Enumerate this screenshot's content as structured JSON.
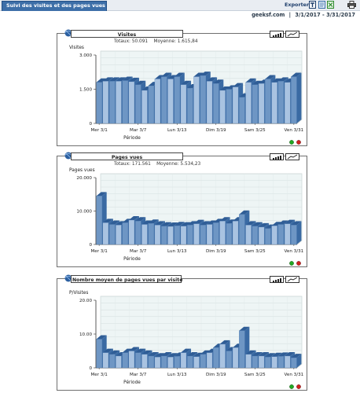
{
  "header": {
    "tab_title": "Suivi des visites et des pages vues",
    "export_label": "Exporter",
    "site": "geeksf.com",
    "separator": "|",
    "date_range": "3/1/2017 - 3/31/2017"
  },
  "chart_data": [
    {
      "type": "bar",
      "title": "Visites",
      "summary": "Totaux: 50.091    Moyenne: 1.615,84",
      "ylabel": "Visites",
      "xlabel": "Période",
      "ylim": [
        0,
        3000
      ],
      "yticks": [
        "0",
        "1.500",
        "3.000"
      ],
      "tick_labels": [
        "Mer 3/1",
        "Mar 3/7",
        "Lun 3/13",
        "Dim 3/19",
        "Sam 3/25",
        "Ven 3/31"
      ],
      "tick_days": [
        1,
        7,
        13,
        19,
        25,
        31
      ],
      "values": [
        1800,
        1850,
        1850,
        1850,
        1880,
        1830,
        1700,
        1450,
        1650,
        1950,
        2050,
        1950,
        2050,
        1700,
        1550,
        2050,
        2100,
        1850,
        1750,
        1450,
        1500,
        1600,
        1150,
        1800,
        1700,
        1750,
        1950,
        1800,
        1850,
        1800,
        2050
      ]
    },
    {
      "type": "bar",
      "title": "Pages vues",
      "summary": "Totaux: 171.561    Moyenne: 5.534,23",
      "ylabel": "Pages vues",
      "xlabel": "Période",
      "ylim": [
        0,
        20000
      ],
      "yticks": [
        "0",
        "10.000",
        "20.000"
      ],
      "tick_labels": [
        "Mer 3/1",
        "Mar 3/7",
        "Lun 3/13",
        "Dim 3/19",
        "Sam 3/25",
        "Ven 3/31"
      ],
      "tick_days": [
        1,
        7,
        13,
        19,
        25,
        31
      ],
      "values": [
        14500,
        6500,
        6000,
        5800,
        6500,
        7300,
        7000,
        6000,
        6300,
        5800,
        5500,
        5400,
        5600,
        5500,
        5800,
        6200,
        5800,
        6000,
        6500,
        7000,
        6300,
        7000,
        9000,
        5800,
        5500,
        5200,
        4800,
        5600,
        6000,
        6200,
        5800
      ]
    },
    {
      "type": "bar",
      "title": "Nombre moyen de pages vues par visite",
      "summary": "",
      "ylabel": "P/Visites",
      "xlabel": "Période",
      "ylim": [
        0,
        20
      ],
      "yticks": [
        "0",
        "10.00",
        "20.00"
      ],
      "tick_labels": [
        "Mer 3/1",
        "Mar 3/7",
        "Lun 3/13",
        "Dim 3/19",
        "Sam 3/25",
        "Ven 3/31"
      ],
      "tick_days": [
        1,
        7,
        13,
        19,
        25,
        31
      ],
      "values": [
        8.5,
        4.5,
        4,
        3.5,
        4.5,
        5,
        4.5,
        4,
        3.5,
        3.2,
        3.5,
        3.2,
        3.4,
        4.5,
        3.5,
        3.3,
        4,
        4.5,
        6,
        7,
        5,
        6,
        11,
        4,
        3.5,
        3.5,
        3.2,
        3.3,
        3.4,
        3.5,
        3
      ]
    }
  ],
  "colors": {
    "bar_front": "#6e96c4",
    "bar_light": "#a9c3e1",
    "bar_top": "#2f5d96",
    "panel_border": "#6f6f6f",
    "plot_bg": "#eef5f5",
    "status_green": "#22a822",
    "status_red": "#d02020"
  },
  "icons": [
    "bar-chart-view-icon",
    "line-chart-view-icon",
    "globe-icon",
    "status-green-icon",
    "status-red-icon"
  ]
}
